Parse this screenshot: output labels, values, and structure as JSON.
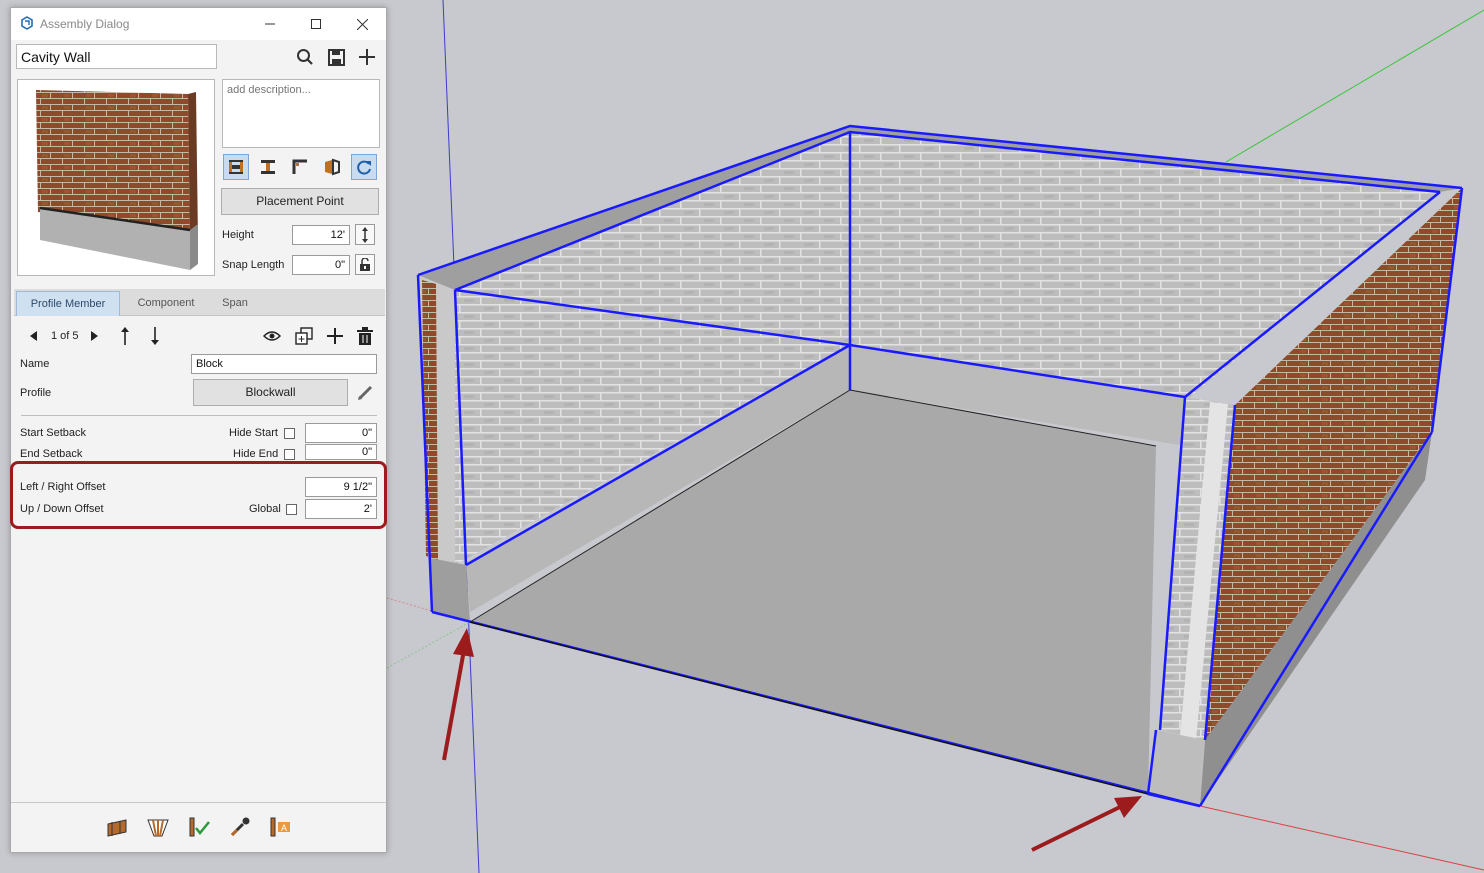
{
  "dialog": {
    "title": "Assembly Dialog",
    "assembly_name": "Cavity Wall",
    "description_placeholder": "add description...",
    "placement_point_label": "Placement Point",
    "height_label": "Height",
    "height_value": "12'",
    "snap_length_label": "Snap Length",
    "snap_length_value": "0\""
  },
  "tabs": [
    {
      "label": "Profile Member",
      "active": true
    },
    {
      "label": "Component",
      "active": false
    },
    {
      "label": "Span",
      "active": false
    }
  ],
  "member": {
    "pager": "1 of 5",
    "name_label": "Name",
    "name_value": "Block",
    "profile_label": "Profile",
    "profile_value": "Blockwall",
    "start_setback_label": "Start Setback",
    "hide_start_label": "Hide Start",
    "start_setback_value": "0\"",
    "end_setback_label": "End Setback",
    "hide_end_label": "Hide End",
    "end_setback_value": "0\"",
    "lr_offset_label": "Left / Right Offset",
    "lr_offset_value": "9 1/2\"",
    "ud_offset_label": "Up / Down Offset",
    "global_label": "Global",
    "ud_offset_value": "2'"
  },
  "icons": {
    "top": [
      "search-icon",
      "save-icon",
      "plus-icon"
    ],
    "toolbar": [
      "justify-both-icon",
      "justify-center-icon",
      "corner-icon",
      "flip-icon",
      "refresh-icon"
    ],
    "member_nav": [
      "prev-arrow-icon",
      "next-arrow-icon",
      "move-up-icon",
      "move-down-icon",
      "eye-icon",
      "duplicate-icon",
      "add-icon",
      "delete-icon"
    ],
    "bottom": [
      "wall-tool-icon",
      "roof-tool-icon",
      "verify-icon",
      "eyedropper-icon",
      "label-tool-icon"
    ]
  },
  "colors": {
    "selection_blue": "#1a1aff",
    "annotation_red": "#9c1b1d",
    "tab_active": "#cfe0f1"
  }
}
